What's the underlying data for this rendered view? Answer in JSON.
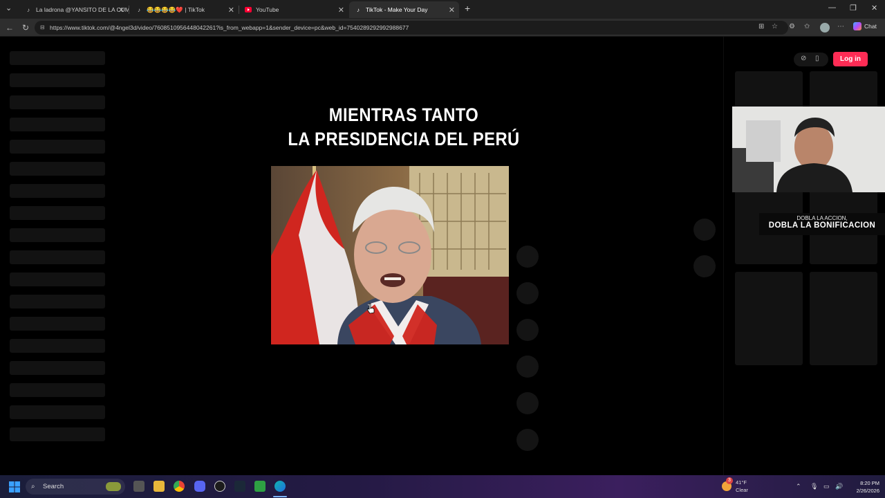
{
  "browser": {
    "tabs": [
      {
        "title": "La ladrona @YANSITO DE LA CUMBIA",
        "icon": "tiktok-icon",
        "active": false
      },
      {
        "title": "😂😂😂😂❤️ | TikTok",
        "icon": "tiktok-icon",
        "active": false
      },
      {
        "title": "YouTube",
        "icon": "youtube-icon",
        "active": false
      },
      {
        "title": "TikTok - Make Your Day",
        "icon": "tiktok-icon",
        "active": true
      }
    ],
    "url": "https://www.tiktok.com/@4ngel3d/video/7608510956448042261?is_from_webapp=1&sender_device=pc&web_id=7540289292992988677",
    "chat_label": "Chat"
  },
  "tiktok": {
    "caption_line1": "MIENTRAS TANTO",
    "caption_line2": "LA PRESIDENCIA DEL PERÚ",
    "login_label": "Log in"
  },
  "overlay": {
    "promo_line1": "DOBLA LA ACCION,",
    "promo_line2": "DOBLA LA BONIFICACION"
  },
  "taskbar": {
    "search_label": "Search",
    "weather_temp": "41°F",
    "weather_cond": "Clear",
    "time": "8:20 PM",
    "date": "2/26/2026",
    "notification_count": "3"
  },
  "colors": {
    "accent": "#fe2c55",
    "flag_red": "#d0261f"
  }
}
